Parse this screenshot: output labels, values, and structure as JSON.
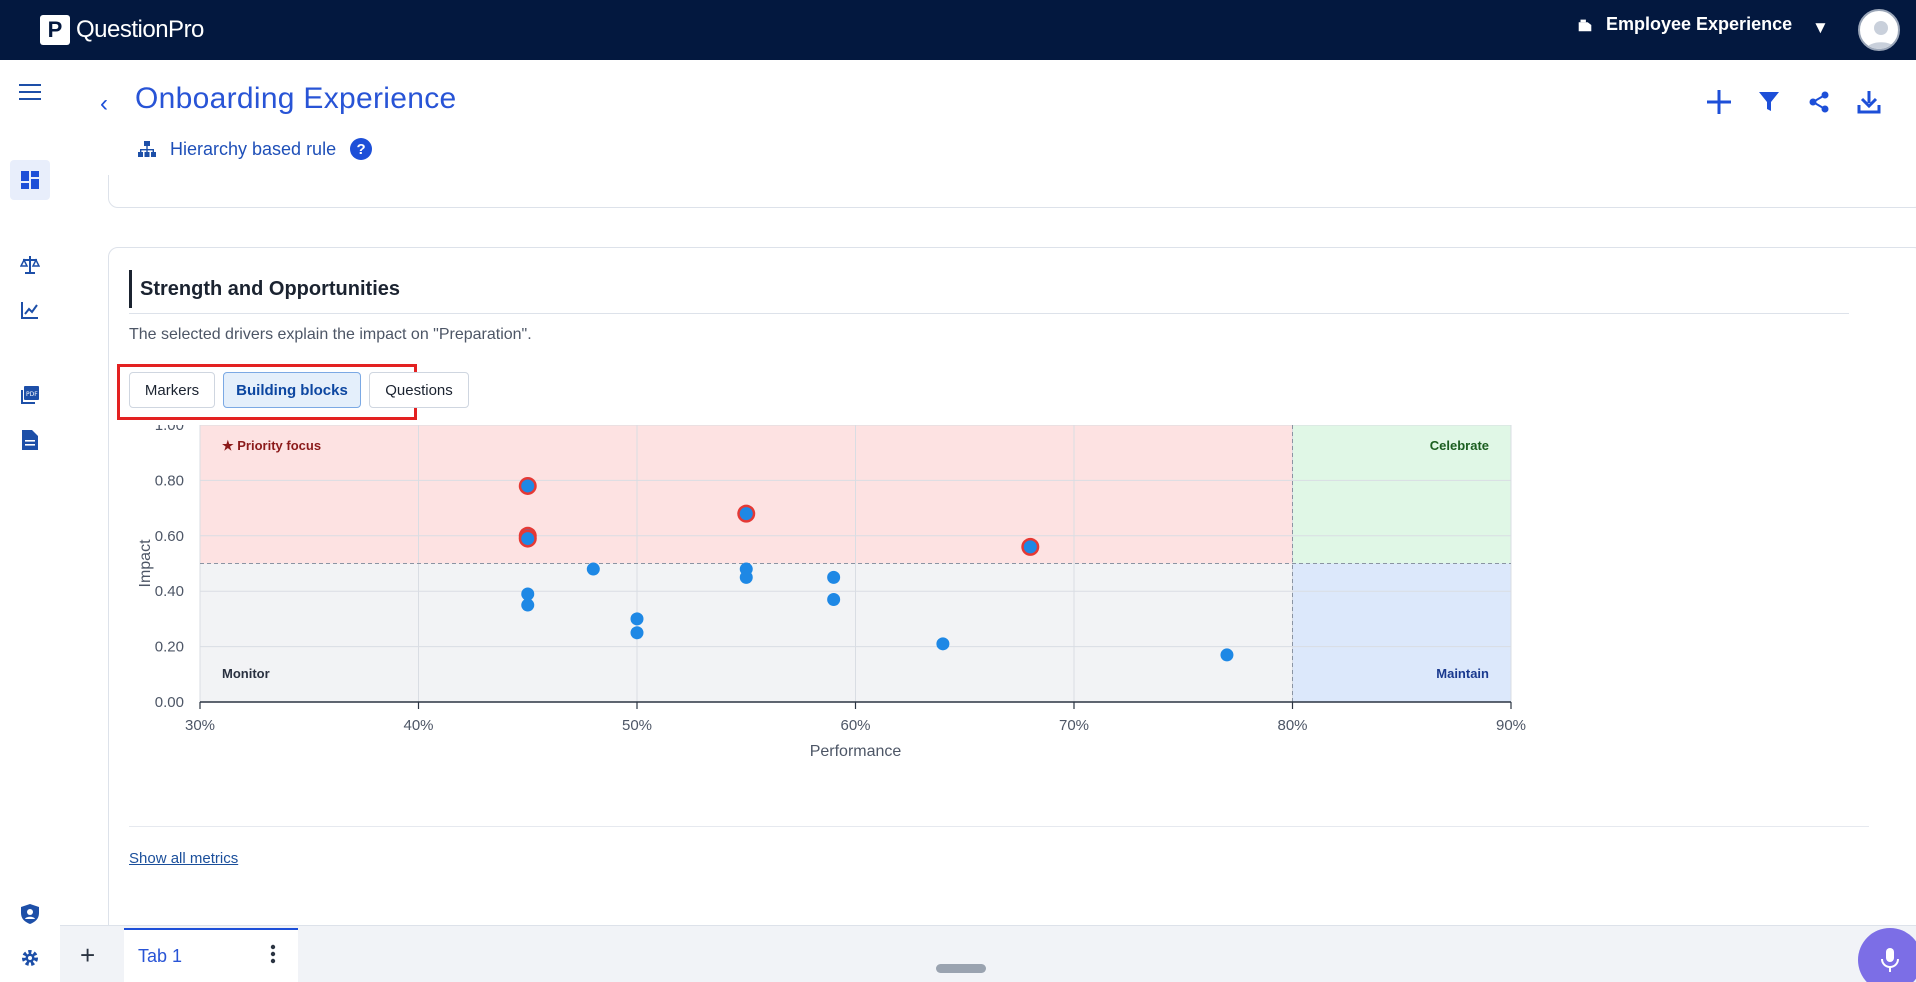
{
  "app": {
    "brand": "QuestionPro",
    "product": "Employee Experience"
  },
  "header": {
    "title": "Onboarding Experience",
    "rule_label": "Hierarchy based rule",
    "help_glyph": "?"
  },
  "rail": {
    "icons": [
      "menu-icon",
      "dashboard-icon",
      "balance-icon",
      "trend-icon",
      "pdf-icon",
      "document-icon",
      "user-shield-icon",
      "gear-icon"
    ]
  },
  "card": {
    "title": "Strength and Opportunities",
    "description": "The selected drivers explain the impact on \"Preparation\".",
    "segments": {
      "markers": "Markers",
      "building_blocks": "Building blocks",
      "questions": "Questions",
      "selected": "Building blocks"
    },
    "show_all": "Show all metrics"
  },
  "chart_data": {
    "type": "scatter",
    "xlabel": "Performance",
    "ylabel": "Impact",
    "xlim": [
      30,
      90
    ],
    "ylim": [
      0,
      1
    ],
    "x_ticks": [
      "30%",
      "40%",
      "50%",
      "60%",
      "70%",
      "80%",
      "90%"
    ],
    "y_ticks": [
      "0.00",
      "0.20",
      "0.40",
      "0.60",
      "0.80",
      "1.00"
    ],
    "x_threshold": 80,
    "y_threshold": 0.5,
    "quadrants": {
      "top_left": "★ Priority focus",
      "top_right": "Celebrate",
      "bottom_left": "Monitor",
      "bottom_right": "Maintain"
    },
    "colors": {
      "point": "#1e88e5",
      "highlight_ring": "#e53935",
      "priority_bg": "#fde2e2",
      "celebrate_bg": "#e0f7e6",
      "monitor_bg": "#f2f3f5",
      "maintain_bg": "#dce8fb",
      "priority_text": "#8b1a1a",
      "celebrate_text": "#1b5e20",
      "monitor_text": "#2a3140",
      "maintain_text": "#1a3a8f"
    },
    "points": [
      {
        "x": 45,
        "y": 0.78,
        "priority": true
      },
      {
        "x": 45,
        "y": 0.6,
        "priority": true
      },
      {
        "x": 45,
        "y": 0.59,
        "priority": true
      },
      {
        "x": 55,
        "y": 0.68,
        "priority": true
      },
      {
        "x": 68,
        "y": 0.56,
        "priority": true
      },
      {
        "x": 48,
        "y": 0.48,
        "priority": false
      },
      {
        "x": 55,
        "y": 0.48,
        "priority": false
      },
      {
        "x": 55,
        "y": 0.45,
        "priority": false
      },
      {
        "x": 59,
        "y": 0.45,
        "priority": false
      },
      {
        "x": 45,
        "y": 0.39,
        "priority": false
      },
      {
        "x": 45,
        "y": 0.35,
        "priority": false
      },
      {
        "x": 59,
        "y": 0.37,
        "priority": false
      },
      {
        "x": 50,
        "y": 0.3,
        "priority": false
      },
      {
        "x": 50,
        "y": 0.25,
        "priority": false
      },
      {
        "x": 64,
        "y": 0.21,
        "priority": false
      },
      {
        "x": 77,
        "y": 0.17,
        "priority": false
      }
    ]
  },
  "tabs": [
    {
      "label": "Tab 1"
    }
  ]
}
